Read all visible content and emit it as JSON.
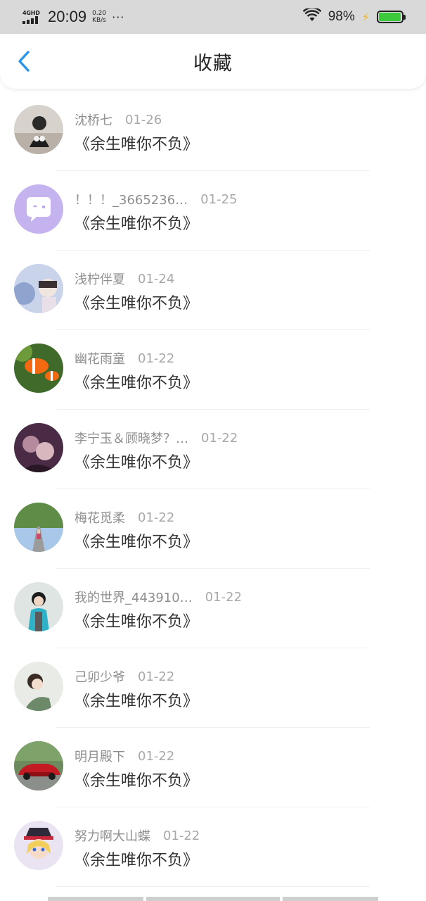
{
  "status_bar": {
    "network": "4GHD",
    "time": "20:09",
    "speed_value": "0.20",
    "speed_unit": "KB/s",
    "dots": "···",
    "battery_percent": "98%",
    "battery_level": 0.98,
    "icons": [
      "signal-icon",
      "wifi-icon",
      "charging-icon",
      "battery-icon"
    ]
  },
  "nav": {
    "back_icon": "chevron-left-icon",
    "title": "收藏",
    "accent_color": "#2b95e9"
  },
  "favorites": [
    {
      "user": "沈桥七",
      "date": "01-26",
      "title": "《余生唯你不负》"
    },
    {
      "user": "！！！_3665236…",
      "date": "01-25",
      "title": "《余生唯你不负》"
    },
    {
      "user": "浅柠伴夏",
      "date": "01-24",
      "title": "《余生唯你不负》"
    },
    {
      "user": "幽花雨童",
      "date": "01-22",
      "title": "《余生唯你不负》"
    },
    {
      "user": "李宁玉＆顾晓梦？…",
      "date": "01-22",
      "title": "《余生唯你不负》"
    },
    {
      "user": "梅花觅柔",
      "date": "01-22",
      "title": "《余生唯你不负》"
    },
    {
      "user": "我的世界_443910…",
      "date": "01-22",
      "title": "《余生唯你不负》"
    },
    {
      "user": "己卯少爷",
      "date": "01-22",
      "title": "《余生唯你不负》"
    },
    {
      "user": "明月殿下",
      "date": "01-22",
      "title": "《余生唯你不负》"
    },
    {
      "user": "努力啊大山蝶",
      "date": "01-22",
      "title": "《余生唯你不负》"
    }
  ]
}
